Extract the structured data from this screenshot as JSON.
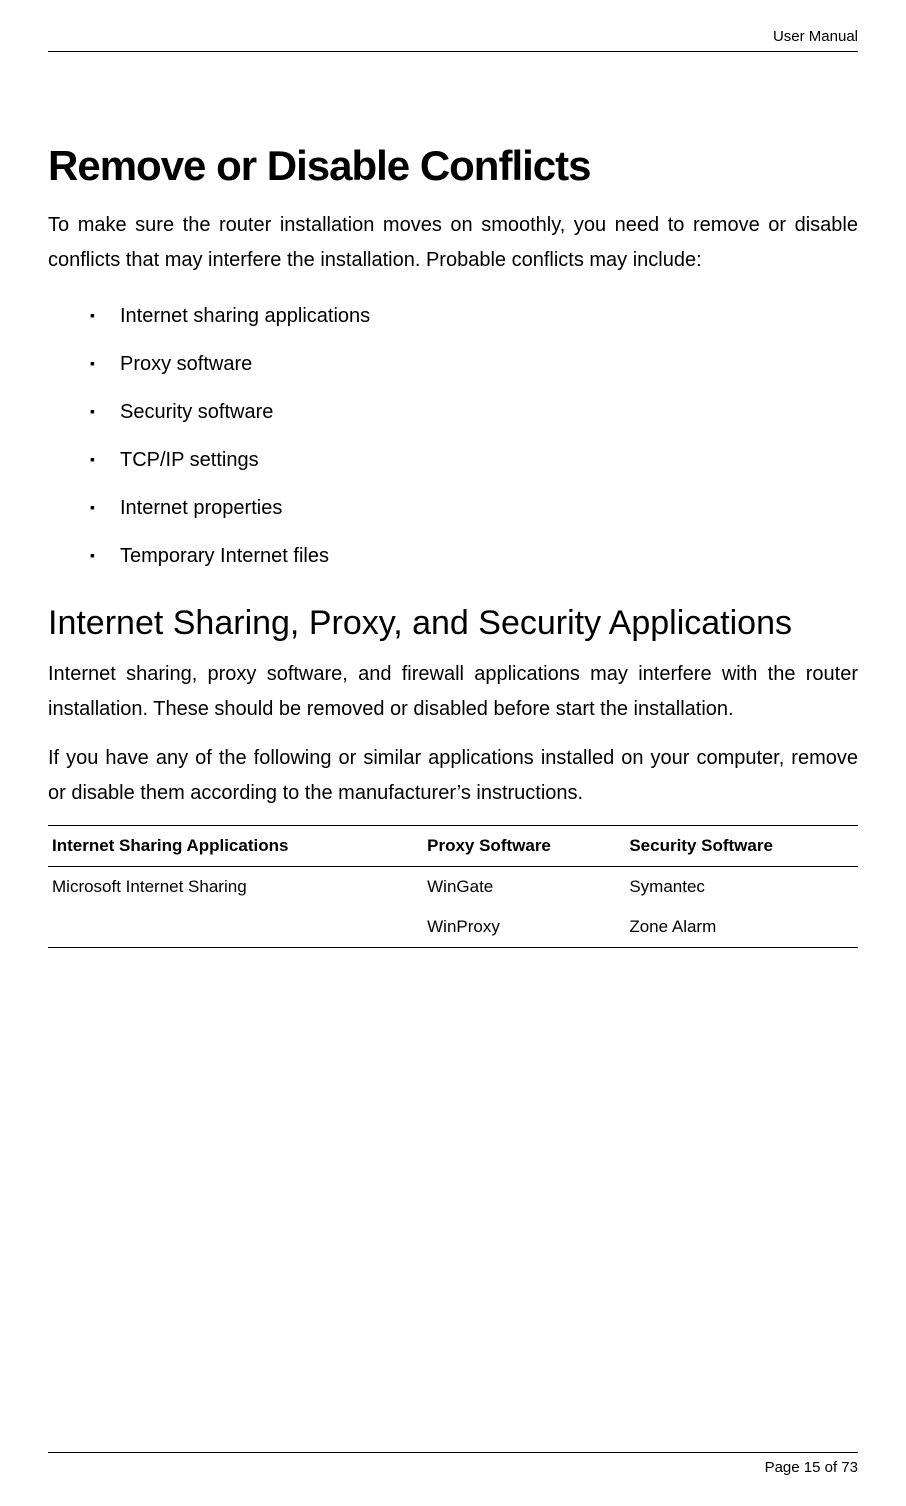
{
  "header": {
    "doc_label": "User Manual"
  },
  "title": "Remove or Disable Conflicts",
  "intro": "To make sure the router installation moves on smoothly, you need to remove or disable conflicts that may interfere the installation. Probable conflicts may include:",
  "bullets": [
    "Internet sharing applications",
    "Proxy software",
    "Security software",
    "TCP/IP settings",
    "Internet properties",
    "Temporary Internet files"
  ],
  "subheading": "Internet Sharing, Proxy, and Security Applications",
  "para1": "Internet sharing, proxy software, and firewall applications may interfere with the router installation. These should be removed or disabled before start the installation.",
  "para2": "If you have any of the following or similar applications installed on your computer, remove or disable them according to the manufacturer’s instructions.",
  "table": {
    "headers": [
      "Internet Sharing Applications",
      "Proxy Software",
      "Security Software"
    ],
    "rows": [
      [
        "Microsoft Internet Sharing",
        "WinGate",
        "Symantec"
      ],
      [
        "",
        "WinProxy",
        "Zone Alarm"
      ]
    ]
  },
  "footer": {
    "page_label": "Page 15 of 73"
  }
}
